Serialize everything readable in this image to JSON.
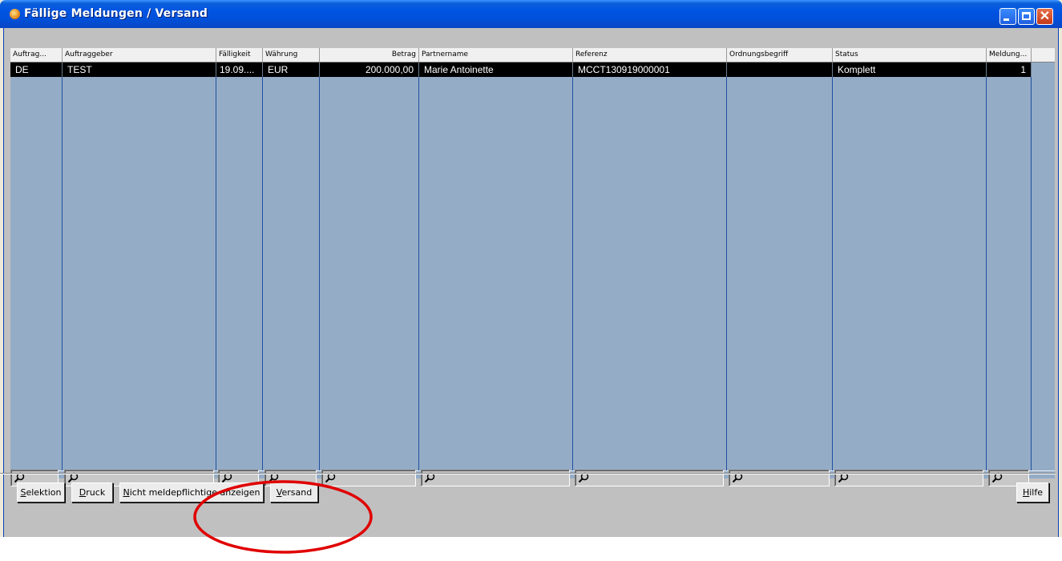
{
  "window": {
    "title": "Fällige Meldungen / Versand",
    "controls": [
      "minimize",
      "maximize",
      "close"
    ]
  },
  "grid": {
    "columns": [
      {
        "label": "Auftrag...",
        "align": "left"
      },
      {
        "label": "Auftraggeber",
        "align": "left"
      },
      {
        "label": "Fälligkeit",
        "align": "left"
      },
      {
        "label": "Währung",
        "align": "left"
      },
      {
        "label": "Betrag",
        "align": "right"
      },
      {
        "label": "Partnername",
        "align": "left"
      },
      {
        "label": "Referenz",
        "align": "left"
      },
      {
        "label": "Ordnungsbegriff",
        "align": "left"
      },
      {
        "label": "Status",
        "align": "left"
      },
      {
        "label": "Meldung...",
        "align": "left"
      }
    ],
    "rows": [
      {
        "cells": [
          "DE",
          "TEST",
          "19.09....",
          "EUR",
          "200.000,00",
          "Marie Antoinette",
          "MCCT130919000001",
          "",
          "Komplett",
          "1"
        ],
        "selected": true
      }
    ]
  },
  "filters": {
    "icon": "magnifier-icon",
    "values": [
      "",
      "",
      "",
      "",
      "",
      "",
      "",
      "",
      "",
      ""
    ]
  },
  "buttons": {
    "selektion": {
      "mnemonic": "S",
      "rest": "elektion"
    },
    "druck": {
      "mnemonic": "D",
      "rest": "ruck"
    },
    "nicht": {
      "mnemonic": "N",
      "rest": "icht meldepflichtige anzeigen"
    },
    "versand": {
      "mnemonic": "V",
      "rest": "ersand"
    },
    "hilfe": {
      "mnemonic": "H",
      "rest": "ilfe"
    }
  },
  "colors": {
    "grid_background": "#94acc6",
    "selected_row": "#000000",
    "annotation_ellipse": "#e00000",
    "titlebar": "#0054e3"
  }
}
